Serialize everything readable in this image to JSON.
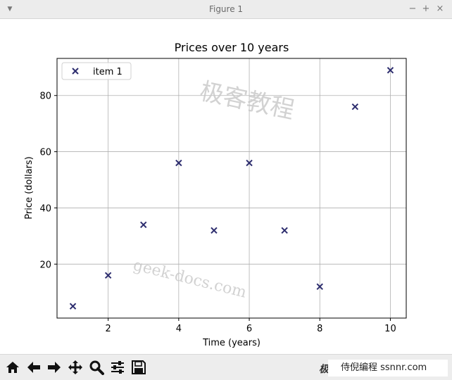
{
  "window": {
    "title": "Figure 1",
    "menu_icon": "chevron-down-icon",
    "minimize_glyph": "−",
    "maximize_glyph": "+",
    "close_glyph": "×"
  },
  "chart_data": {
    "type": "scatter",
    "title": "Prices over 10 years",
    "xlabel": "Time (years)",
    "ylabel": "Price (dollars)",
    "x": [
      1,
      2,
      3,
      4,
      5,
      6,
      7,
      8,
      9,
      10
    ],
    "series": [
      {
        "name": "item 1",
        "y": [
          5,
          16,
          34,
          56,
          32,
          56,
          32,
          12,
          76,
          89
        ],
        "marker": "x",
        "color": "#2d2d6e"
      }
    ],
    "xlim": [
      0.55,
      10.45
    ],
    "ylim": [
      0.8,
      93.2
    ],
    "xticks": [
      2,
      4,
      6,
      8,
      10
    ],
    "yticks": [
      20,
      40,
      60,
      80
    ],
    "grid": true,
    "legend_position": "top-left"
  },
  "watermarks": {
    "upper": "极客教程",
    "lower": "geek-docs.com",
    "corner": "极",
    "badge": "侍倪编程 ssnnr.com"
  },
  "toolbar": {
    "items": [
      {
        "icon": "home-icon"
      },
      {
        "icon": "back-arrow-icon"
      },
      {
        "icon": "forward-arrow-icon"
      },
      {
        "icon": "pan-icon"
      },
      {
        "icon": "zoom-icon"
      },
      {
        "icon": "configure-subplots-icon"
      },
      {
        "icon": "save-icon"
      }
    ]
  }
}
